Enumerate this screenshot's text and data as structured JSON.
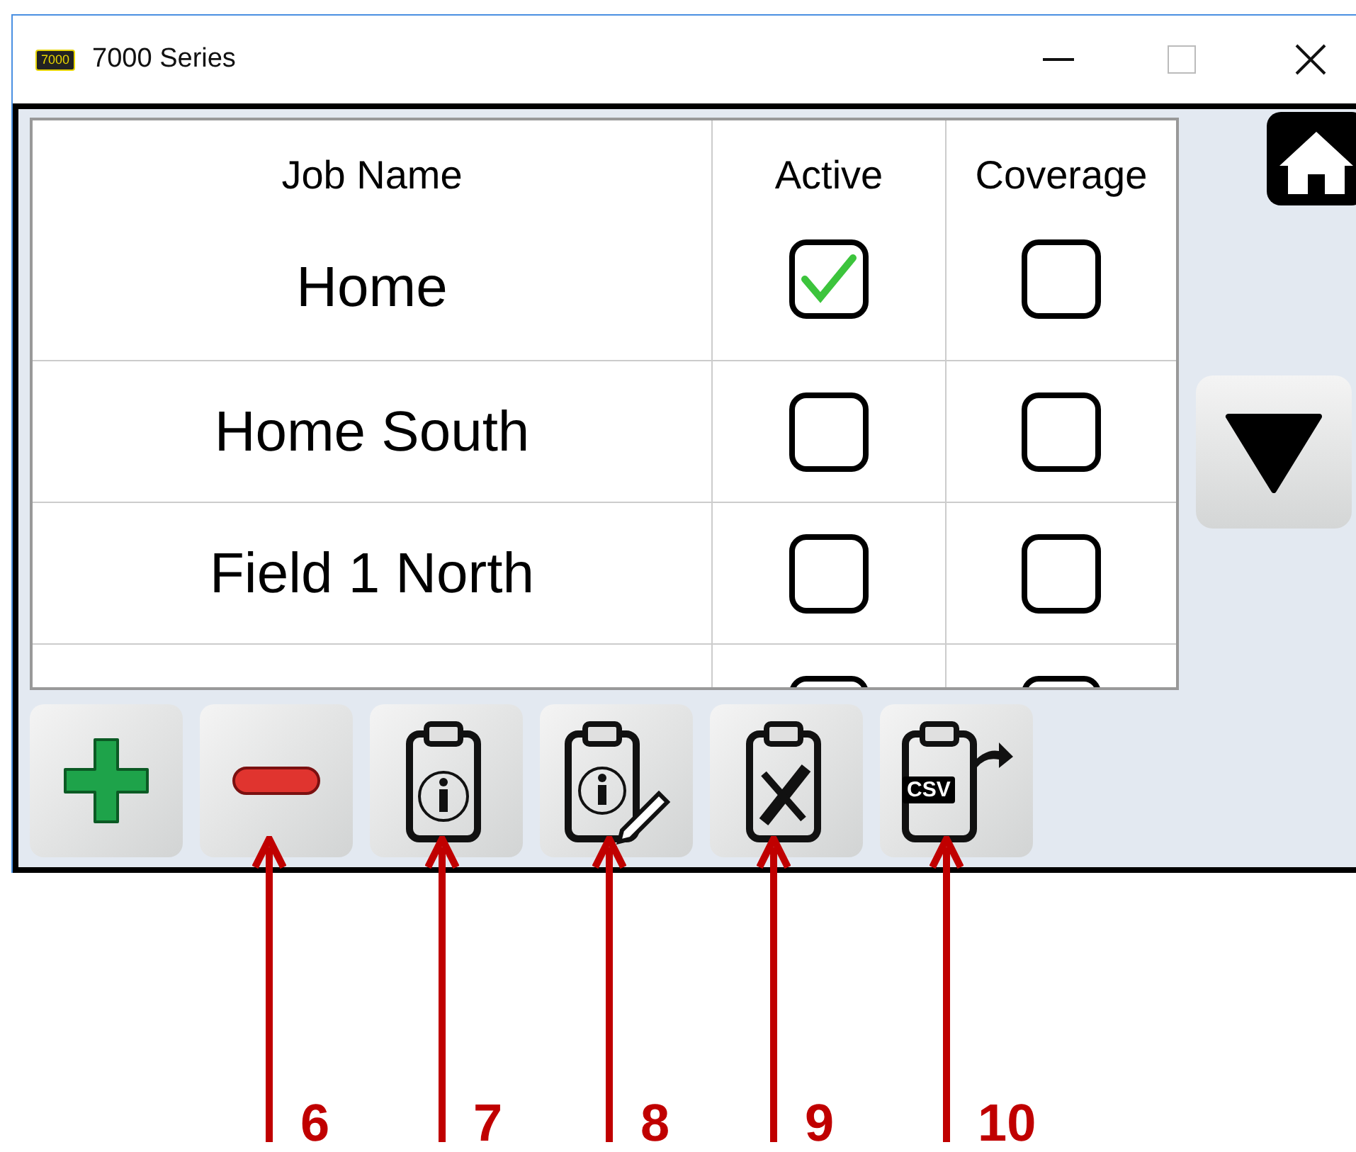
{
  "window": {
    "title": "7000 Series",
    "logo_text": "7000"
  },
  "table": {
    "columns": [
      "Job Name",
      "Active",
      "Coverage"
    ],
    "rows": [
      {
        "kind": "full",
        "name": "Home",
        "active": true,
        "coverage": false
      },
      {
        "kind": "full",
        "name": "Home South",
        "active": false,
        "coverage": false
      },
      {
        "kind": "full",
        "name": "Field 1 North",
        "active": false,
        "coverage": false
      },
      {
        "kind": "partial"
      }
    ]
  },
  "toolbar": [
    {
      "kind": "add"
    },
    {
      "kind": "remove"
    },
    {
      "kind": "info"
    },
    {
      "kind": "edit"
    },
    {
      "kind": "tools"
    },
    {
      "kind": "csv",
      "label": "CSV"
    }
  ],
  "callouts": [
    "6",
    "7",
    "8",
    "9",
    "10"
  ]
}
